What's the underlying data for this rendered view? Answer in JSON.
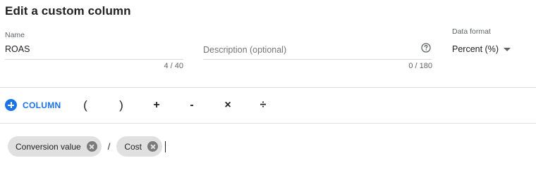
{
  "title": "Edit a custom column",
  "name": {
    "label": "Name",
    "value": "ROAS",
    "count": "4 / 40"
  },
  "description": {
    "placeholder": "Description (optional)",
    "count": "0 / 180",
    "help_icon": "help-circle-icon"
  },
  "data_format": {
    "label": "Data format",
    "value": "Percent (%)"
  },
  "toolbar": {
    "column_label": "COLUMN",
    "operators": [
      "(",
      ")",
      "+",
      "-",
      "×",
      "÷"
    ]
  },
  "formula": {
    "chips": [
      "Conversion value",
      "Cost"
    ],
    "operator": "/"
  },
  "colors": {
    "accent": "#1a73e8",
    "chip_bg": "#e0e0e0",
    "text": "#202124",
    "muted": "#5f6368"
  }
}
